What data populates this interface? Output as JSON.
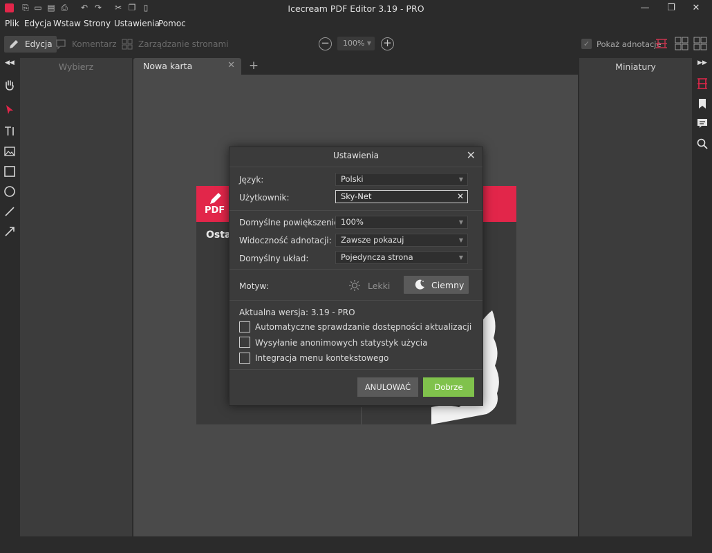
{
  "window": {
    "title": "Icecream PDF Editor 3.19 - PRO",
    "controls": [
      "minimize",
      "restore",
      "close"
    ]
  },
  "menu": [
    "Plik",
    "Edycja",
    "Wstaw",
    "Strony",
    "Ustawienia",
    "Pomoc"
  ],
  "toolbar": {
    "modes": [
      {
        "label": "Edycja",
        "active": true
      },
      {
        "label": "Komentarz",
        "active": false
      },
      {
        "label": "Zarządzanie stronami",
        "active": false
      }
    ],
    "zoom_value": "100%",
    "show_annotations_label": "Pokaż adnotacje",
    "show_annotations_checked": true
  },
  "left_panel": {
    "header": "Wybierz"
  },
  "right_panel": {
    "header": "Miniatury"
  },
  "tabs": [
    {
      "label": "Nowa karta"
    }
  ],
  "welcome_page": {
    "logo_text": "PDF",
    "peek_text": "Ostat"
  },
  "dialog": {
    "title": "Ustawienia",
    "fields": {
      "language": {
        "label": "Język:",
        "value": "Polski"
      },
      "user": {
        "label": "Użytkownik:",
        "value": "Sky-Net"
      },
      "default_zoom": {
        "label": "Domyślne powiększenie:",
        "value": "100%"
      },
      "annotation_visibility": {
        "label": "Widoczność adnotacji:",
        "value": "Zawsze pokazuj"
      },
      "default_layout": {
        "label": "Domyślny układ:",
        "value": "Pojedyncza strona"
      }
    },
    "theme": {
      "label": "Motyw:",
      "light_label": "Lekki",
      "dark_label": "Ciemny",
      "selected": "dark"
    },
    "version_text": "Aktualna wersja: 3.19 - PRO",
    "checkboxes": [
      {
        "label": "Automatyczne sprawdzanie dostępności aktualizacji",
        "checked": false
      },
      {
        "label": "Wysyłanie anonimowych statystyk użycia",
        "checked": false
      },
      {
        "label": "Integracja menu kontekstowego",
        "checked": false
      }
    ],
    "cancel_label": "ANULOWAĆ",
    "ok_label": "Dobrze"
  },
  "colors": {
    "accent_red": "#e2264a",
    "ok_green": "#80c24c",
    "background": "#2b2b2b",
    "panel": "#3c3c3c"
  }
}
